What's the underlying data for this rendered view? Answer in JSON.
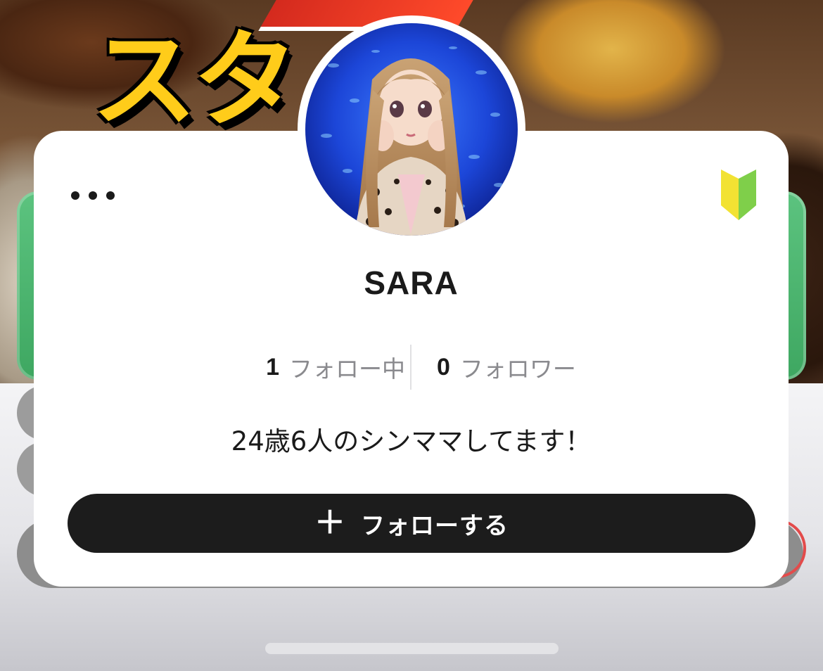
{
  "background": {
    "title_text": "スタ",
    "colors": {
      "banner_green": "#4cb46f",
      "title_yellow": "#ffcc1a"
    }
  },
  "profile": {
    "username": "SARA",
    "following_count": "1",
    "following_label": "フォロー中",
    "followers_count": "0",
    "followers_label": "フォロワー",
    "bio": "24歳6人のシンママしてます！",
    "follow_button": {
      "icon": "plus-icon",
      "label": "フォローする"
    },
    "more_button_icon": "ellipsis-icon",
    "badge_icon": "beginner-mark-icon"
  },
  "colors": {
    "button_bg": "#1c1c1c",
    "label_gray": "#8a8a8e",
    "text_dark": "#1a1a1a",
    "beginner_yellow": "#f2e233",
    "beginner_green": "#7fcf4a"
  }
}
